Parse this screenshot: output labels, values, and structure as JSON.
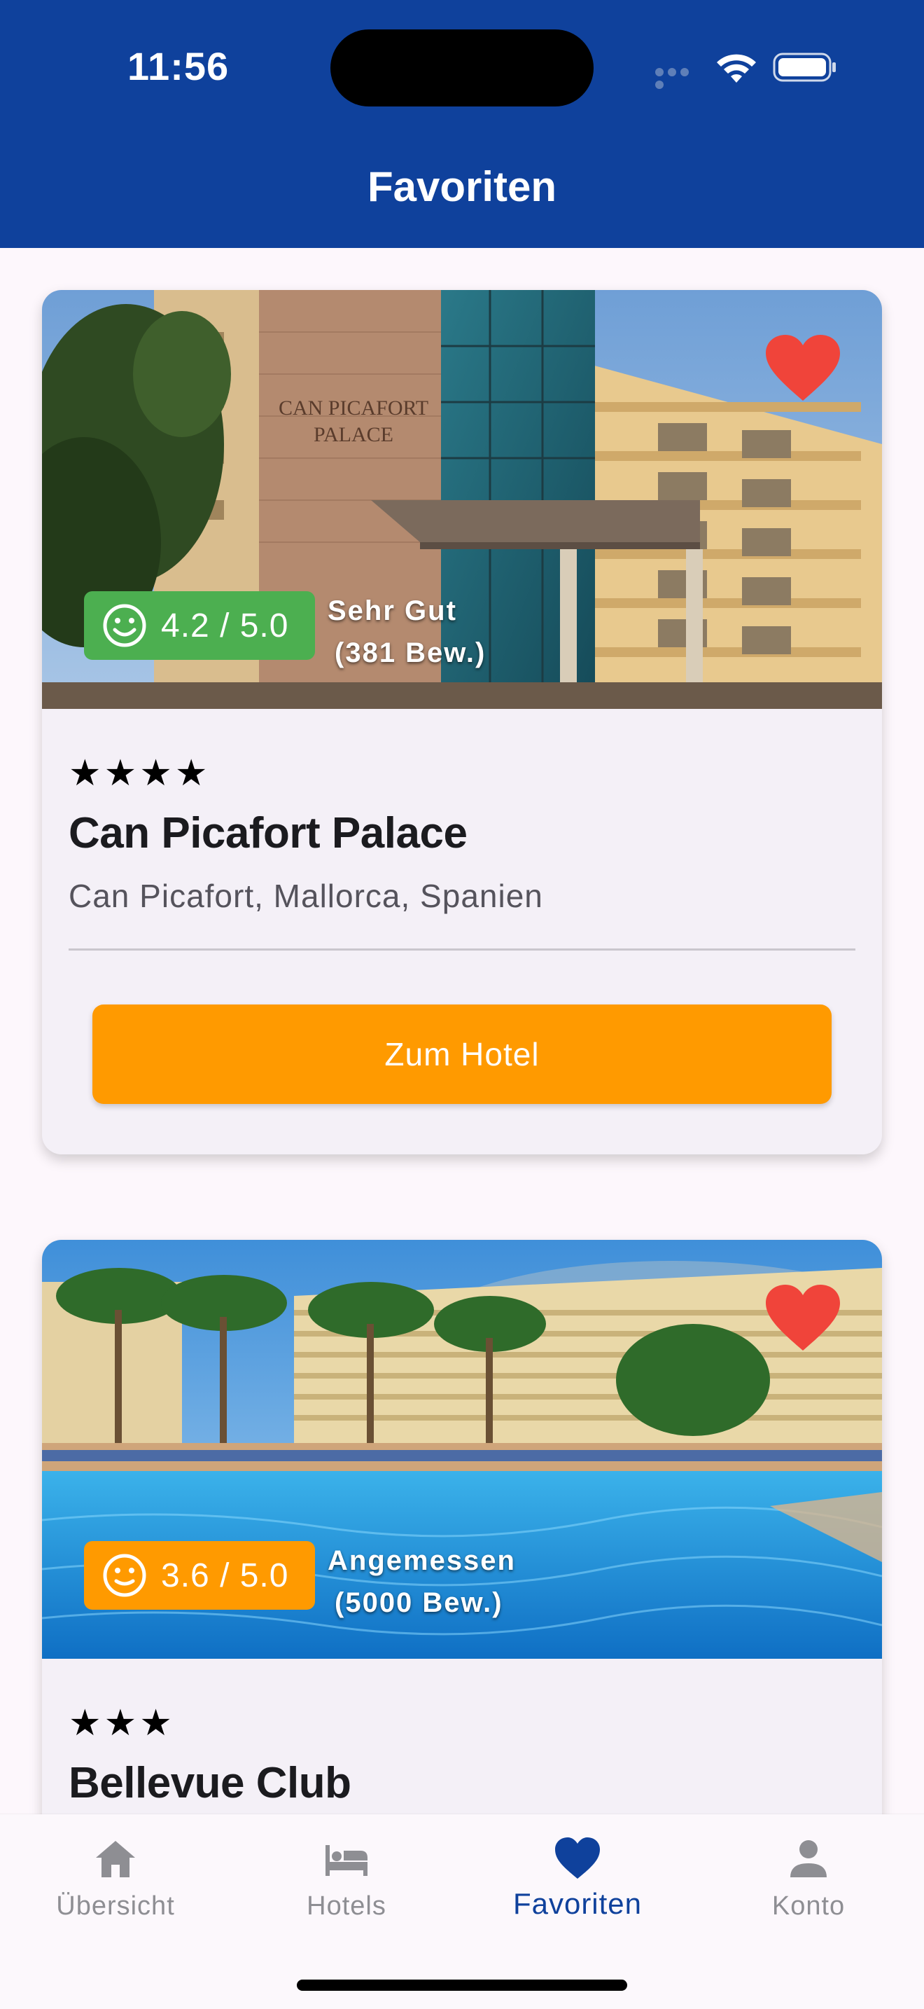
{
  "status_bar": {
    "time": "11:56"
  },
  "header": {
    "title": "Favoriten"
  },
  "hotels": [
    {
      "favorite": true,
      "rating_value": "4.2 / 5.0",
      "rating_label": "Sehr Gut",
      "review_count": "(381 Bew.)",
      "rating_color": "#4caf50",
      "stars": "★★★★",
      "name": "Can Picafort Palace",
      "location": "Can Picafort, Mallorca, Spanien",
      "button_label": "Zum Hotel",
      "photo_sign_line1": "CAN PICAFORT",
      "photo_sign_line2": "PALACE"
    },
    {
      "favorite": true,
      "rating_value": "3.6 / 5.0",
      "rating_label": "Angemessen",
      "review_count": "(5000 Bew.)",
      "rating_color": "#ff9a00",
      "stars": "★★★",
      "name": "Bellevue Club"
    }
  ],
  "tabs": [
    {
      "label": "Übersicht",
      "icon": "home-icon",
      "active": false
    },
    {
      "label": "Hotels",
      "icon": "bed-icon",
      "active": false
    },
    {
      "label": "Favoriten",
      "icon": "heart-icon",
      "active": true
    },
    {
      "label": "Konto",
      "icon": "person-icon",
      "active": false
    }
  ],
  "colors": {
    "primary": "#0f419c",
    "accent_orange": "#ff9a00",
    "favorite_red": "#f0443a",
    "rating_green": "#4caf50"
  }
}
